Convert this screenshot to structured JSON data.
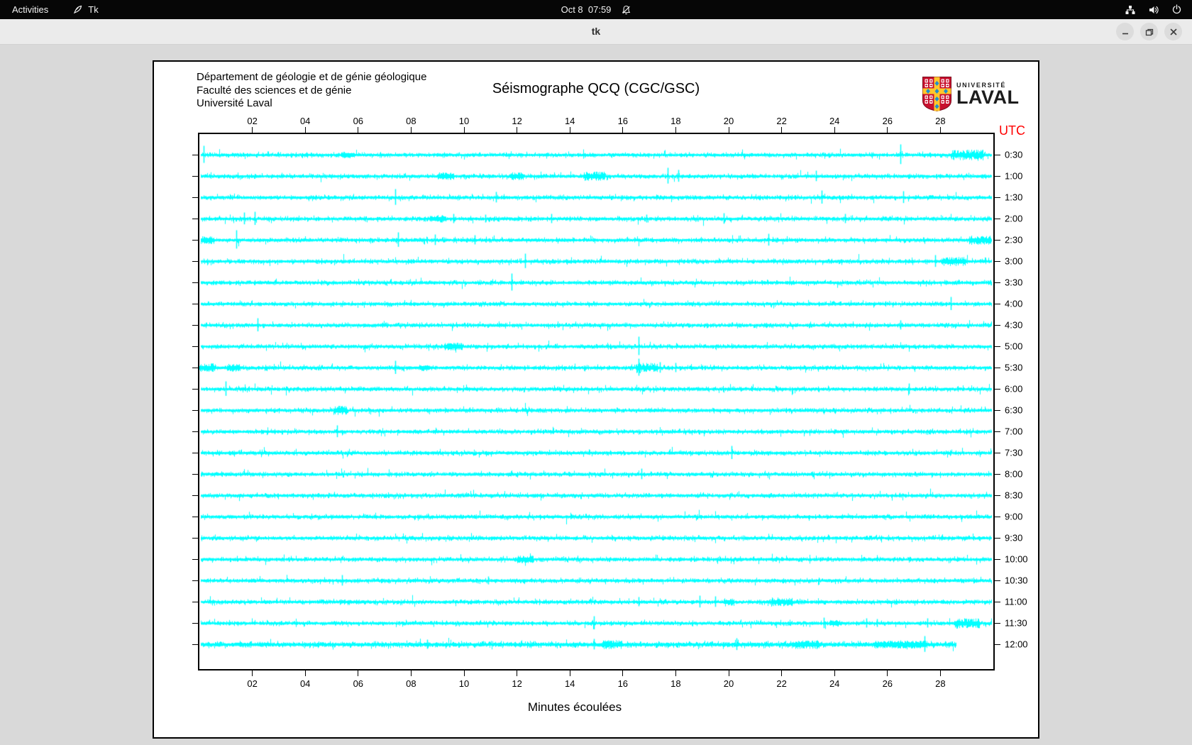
{
  "top_bar": {
    "activities_label": "Activities",
    "app_button_label": "Tk",
    "clock": "Oct 8  07:59",
    "icons": [
      "tk-feather-icon",
      "notifications-muted-icon",
      "network-wired-icon",
      "volume-icon",
      "power-icon"
    ]
  },
  "window": {
    "title": "tk",
    "controls": [
      "minimize",
      "maximize",
      "close"
    ]
  },
  "page": {
    "address_lines": [
      "Département de géologie et de génie géologique",
      "Faculté des sciences et de génie",
      "Université Laval"
    ],
    "title": "Séismographe QCQ (CGC/GSC)",
    "logo": {
      "top": "UNIVERSITÉ",
      "bottom": "LAVAL"
    },
    "utc_label": "UTC",
    "x_axis_label": "Minutes écoulées"
  },
  "chart_data": {
    "type": "line",
    "title": "Séismographe QCQ (CGC/GSC)",
    "xlabel": "Minutes écoulées",
    "ylabel": "UTC",
    "x_range_minutes": [
      0,
      30
    ],
    "x_ticks": [
      "02",
      "04",
      "06",
      "08",
      "10",
      "12",
      "14",
      "16",
      "18",
      "20",
      "22",
      "24",
      "26",
      "28"
    ],
    "trace_color": "#00ffff",
    "minutes_per_row": 30,
    "rows": [
      {
        "label": "0:30",
        "events": [
          [
            0.15,
            13,
            "s"
          ],
          [
            5.6,
            3,
            "b",
            0.5
          ],
          [
            26.5,
            15,
            "s"
          ],
          [
            29.0,
            6,
            "b",
            1.2
          ]
        ]
      },
      {
        "label": "1:00",
        "events": [
          [
            9.3,
            4,
            "b",
            0.6
          ],
          [
            12.0,
            4,
            "b",
            0.5
          ],
          [
            14.9,
            5,
            "b",
            0.8
          ],
          [
            17.7,
            12,
            "s"
          ],
          [
            18.1,
            9,
            "s"
          ],
          [
            23.3,
            8,
            "s"
          ]
        ]
      },
      {
        "label": "1:30",
        "events": [
          [
            7.4,
            12,
            "s"
          ],
          [
            11.2,
            8,
            "s"
          ],
          [
            23.5,
            10,
            "s"
          ],
          [
            26.6,
            9,
            "s"
          ]
        ]
      },
      {
        "label": "2:00",
        "events": [
          [
            1.7,
            9,
            "s"
          ],
          [
            2.1,
            10,
            "s"
          ],
          [
            9.0,
            4,
            "b",
            0.6
          ],
          [
            9.6,
            7,
            "s"
          ],
          [
            10.8,
            6,
            "s"
          ],
          [
            13.3,
            7,
            "s"
          ],
          [
            16.9,
            6,
            "s"
          ],
          [
            19.8,
            8,
            "s"
          ],
          [
            24.4,
            7,
            "s"
          ]
        ]
      },
      {
        "label": "2:30",
        "events": [
          [
            0.3,
            4,
            "b",
            0.5
          ],
          [
            1.4,
            14,
            "s"
          ],
          [
            7.5,
            11,
            "s"
          ],
          [
            8.9,
            8,
            "s"
          ],
          [
            10.4,
            7,
            "s"
          ],
          [
            21.5,
            9,
            "s"
          ],
          [
            29.5,
            5,
            "b",
            0.8
          ]
        ]
      },
      {
        "label": "3:00",
        "events": [
          [
            12.3,
            11,
            "s"
          ],
          [
            27.8,
            9,
            "s"
          ],
          [
            28.5,
            5,
            "b",
            0.9
          ]
        ]
      },
      {
        "label": "3:30",
        "events": [
          [
            11.8,
            13,
            "s"
          ]
        ]
      },
      {
        "label": "4:00",
        "events": [
          [
            28.4,
            10,
            "s"
          ]
        ]
      },
      {
        "label": "4:30",
        "events": [
          [
            2.2,
            10,
            "s"
          ],
          [
            26.5,
            7,
            "s"
          ]
        ]
      },
      {
        "label": "5:00",
        "events": [
          [
            9.6,
            4,
            "b",
            0.7
          ],
          [
            16.6,
            14,
            "s"
          ]
        ]
      },
      {
        "label": "5:30",
        "events": [
          [
            0.3,
            5,
            "b",
            0.6
          ],
          [
            1.3,
            4,
            "b",
            0.5
          ],
          [
            7.4,
            10,
            "s"
          ],
          [
            8.5,
            3,
            "b",
            0.4
          ],
          [
            16.6,
            13,
            "s"
          ],
          [
            16.9,
            6,
            "b",
            0.8
          ],
          [
            17.4,
            8,
            "s"
          ],
          [
            18.0,
            7,
            "s"
          ]
        ]
      },
      {
        "label": "6:00",
        "events": [
          [
            1.0,
            11,
            "s"
          ],
          [
            26.8,
            8,
            "s"
          ]
        ]
      },
      {
        "label": "6:30",
        "events": [
          [
            5.3,
            5,
            "b",
            0.5
          ]
        ]
      },
      {
        "label": "7:00",
        "events": [
          [
            5.2,
            9,
            "s"
          ]
        ]
      },
      {
        "label": "7:30",
        "events": [
          [
            20.1,
            10,
            "s"
          ]
        ]
      },
      {
        "label": "8:00",
        "events": [
          [
            16.7,
            8,
            "s"
          ]
        ]
      },
      {
        "label": "8:30",
        "events": []
      },
      {
        "label": "9:00",
        "events": []
      },
      {
        "label": "9:30",
        "events": []
      },
      {
        "label": "10:00",
        "events": [
          [
            12.3,
            4,
            "b",
            0.6
          ]
        ]
      },
      {
        "label": "10:30",
        "events": [
          [
            5.4,
            8,
            "s"
          ],
          [
            10.9,
            6,
            "s"
          ]
        ]
      },
      {
        "label": "11:00",
        "events": [
          [
            16.6,
            7,
            "s"
          ],
          [
            18.9,
            9,
            "s"
          ],
          [
            19.5,
            8,
            "s"
          ],
          [
            20.0,
            4,
            "b",
            0.4
          ],
          [
            22.0,
            5,
            "b",
            0.8
          ]
        ]
      },
      {
        "label": "11:30",
        "events": [
          [
            14.9,
            10,
            "s"
          ],
          [
            23.6,
            8,
            "s"
          ],
          [
            24.0,
            3,
            "b",
            0.4
          ],
          [
            25.2,
            7,
            "s"
          ],
          [
            25.6,
            6,
            "s"
          ],
          [
            27.5,
            7,
            "s"
          ],
          [
            29.0,
            6,
            "b",
            0.9
          ]
        ]
      },
      {
        "label": "12:00",
        "events": [
          [
            8.6,
            7,
            "s"
          ],
          [
            14.9,
            8,
            "s"
          ],
          [
            15.6,
            5,
            "b",
            0.7
          ],
          [
            20.3,
            9,
            "s"
          ],
          [
            22.9,
            5,
            "b",
            1.0
          ],
          [
            26.5,
            4,
            "b",
            2.0
          ],
          [
            27.4,
            12,
            "s"
          ]
        ],
        "end_minute": 28.6,
        "dense": true
      }
    ]
  }
}
